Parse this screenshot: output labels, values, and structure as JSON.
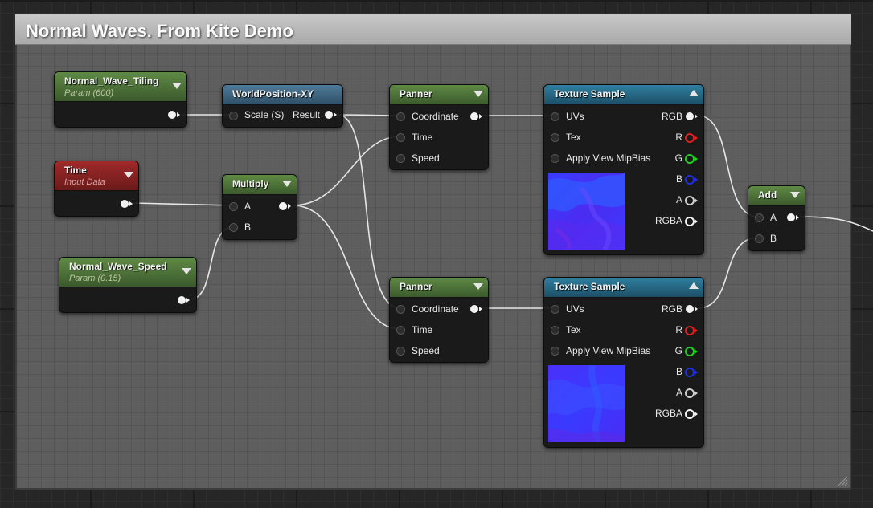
{
  "comment": {
    "title": "Normal Waves. From Kite Demo"
  },
  "nodes": {
    "normal_wave_tiling": {
      "title": "Normal_Wave_Tiling",
      "subtitle": "Param (600)"
    },
    "time": {
      "title": "Time",
      "subtitle": "Input Data"
    },
    "normal_wave_speed": {
      "title": "Normal_Wave_Speed",
      "subtitle": "Param (0.15)"
    },
    "world_position": {
      "title": "WorldPosition-XY",
      "input": "Scale (S)",
      "output": "Result"
    },
    "multiply": {
      "title": "Multiply",
      "inputs": [
        "A",
        "B"
      ]
    },
    "panner_top": {
      "title": "Panner",
      "inputs": [
        "Coordinate",
        "Time",
        "Speed"
      ]
    },
    "panner_bottom": {
      "title": "Panner",
      "inputs": [
        "Coordinate",
        "Time",
        "Speed"
      ]
    },
    "texture_top": {
      "title": "Texture Sample",
      "inputs": [
        "UVs",
        "Tex",
        "Apply View MipBias"
      ],
      "outputs": [
        "RGB",
        "R",
        "G",
        "B",
        "A",
        "RGBA"
      ]
    },
    "texture_bottom": {
      "title": "Texture Sample",
      "inputs": [
        "UVs",
        "Tex",
        "Apply View MipBias"
      ],
      "outputs": [
        "RGB",
        "R",
        "G",
        "B",
        "A",
        "RGBA"
      ]
    },
    "add": {
      "title": "Add",
      "inputs": [
        "A",
        "B"
      ]
    }
  },
  "colors": {
    "param_header": "#4f7a3a",
    "function_header": "#3f6a88",
    "input_data_header": "#8c2323",
    "texture_header": "#2a7090",
    "pin_r": "#e02020",
    "pin_g": "#20d020",
    "pin_b": "#2030e0",
    "wire": "#e6e6e6"
  }
}
